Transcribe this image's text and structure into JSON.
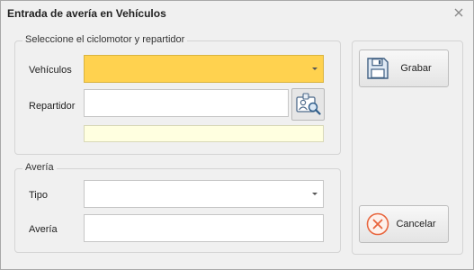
{
  "window": {
    "title": "Entrada de avería en Vehículos"
  },
  "group_vehicle": {
    "legend": "Seleccione el ciclomotor y repartidor",
    "vehiculos_label": "Vehículos",
    "vehiculos_value": "",
    "repartidor_label": "Repartidor",
    "repartidor_value": "",
    "info_value": ""
  },
  "group_averia": {
    "legend": "Avería",
    "tipo_label": "Tipo",
    "tipo_value": "",
    "averia_label": "Avería",
    "averia_value": ""
  },
  "actions": {
    "save_label": "Grabar",
    "cancel_label": "Cancelar"
  },
  "colors": {
    "required_field": "#ffd24f",
    "info_field": "#ffffe0",
    "cancel_accent": "#e8643c"
  },
  "icons": {
    "close": "close-icon",
    "lookup": "id-card-search-icon",
    "save": "floppy-disk-icon",
    "cancel": "cancel-circle-icon"
  }
}
